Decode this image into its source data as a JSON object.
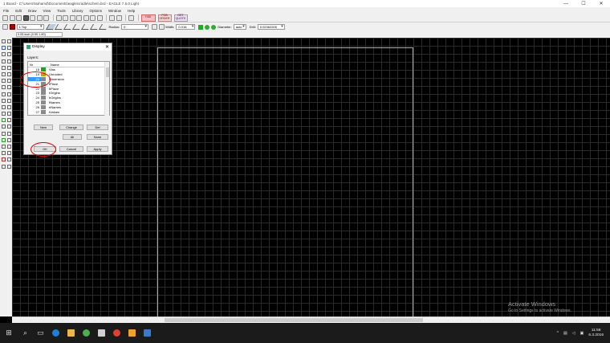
{
  "window": {
    "title": "1 Board - C:\\Users\\Nohamd\\Documents\\eagle\\cradle\\schem.brd - EAGLE 7.5.0 Light",
    "minimize": "—",
    "maximize": "☐",
    "close": "✕"
  },
  "menu": [
    "File",
    "Edit",
    "Draw",
    "View",
    "Tools",
    "Library",
    "Options",
    "Window",
    "Help"
  ],
  "toolbar": {
    "btn1": "FAB",
    "btn2": "PCB ORDER",
    "btn3": "GET QUOTE"
  },
  "toolbar2": {
    "layer_value": "1 Top",
    "radius_label": "Radius:",
    "radius_value": "0",
    "width_label": "Width:",
    "width_value": "0.016",
    "diameter_label": "Diameter:",
    "diameter_value": "auto",
    "drill_label": "Drill:",
    "drill_value": "0.02362205"
  },
  "coord": "0.05 inch (0.90 1.80)",
  "dialog": {
    "title": "Display",
    "close": "✕",
    "layers_label": "Layers:",
    "col_no": "Nr",
    "col_name": "Name",
    "rows": [
      {
        "no": "18",
        "name": "Vias",
        "color": "#2d9a2d"
      },
      {
        "no": "19",
        "name": "Unrouted",
        "color": "#c8a000"
      },
      {
        "no": "20",
        "name": "Dimension",
        "color": "#8a8a8a"
      },
      {
        "no": "21",
        "name": "tPlace",
        "color": "#8a8a8a"
      },
      {
        "no": "22",
        "name": "bPlace",
        "color": "#8a8a8a"
      },
      {
        "no": "23",
        "name": "tOrigins",
        "color": "#8a8a8a"
      },
      {
        "no": "24",
        "name": "bOrigins",
        "color": "#8a8a8a"
      },
      {
        "no": "25",
        "name": "tNames",
        "color": "#8a8a8a"
      },
      {
        "no": "26",
        "name": "bNames",
        "color": "#8a8a8a"
      },
      {
        "no": "27",
        "name": "tValues",
        "color": "#8a8a8a"
      }
    ],
    "buttons": {
      "new": "New",
      "change": "Change",
      "del": "Del",
      "all": "All",
      "none": "None",
      "ok": "OK",
      "cancel": "Cancel",
      "apply": "Apply"
    }
  },
  "watermark": {
    "line1": "Activate Windows",
    "line2": "Go to Settings to activate Windows."
  },
  "taskbar": {
    "time": "11:58",
    "date": "6.3.2016"
  }
}
